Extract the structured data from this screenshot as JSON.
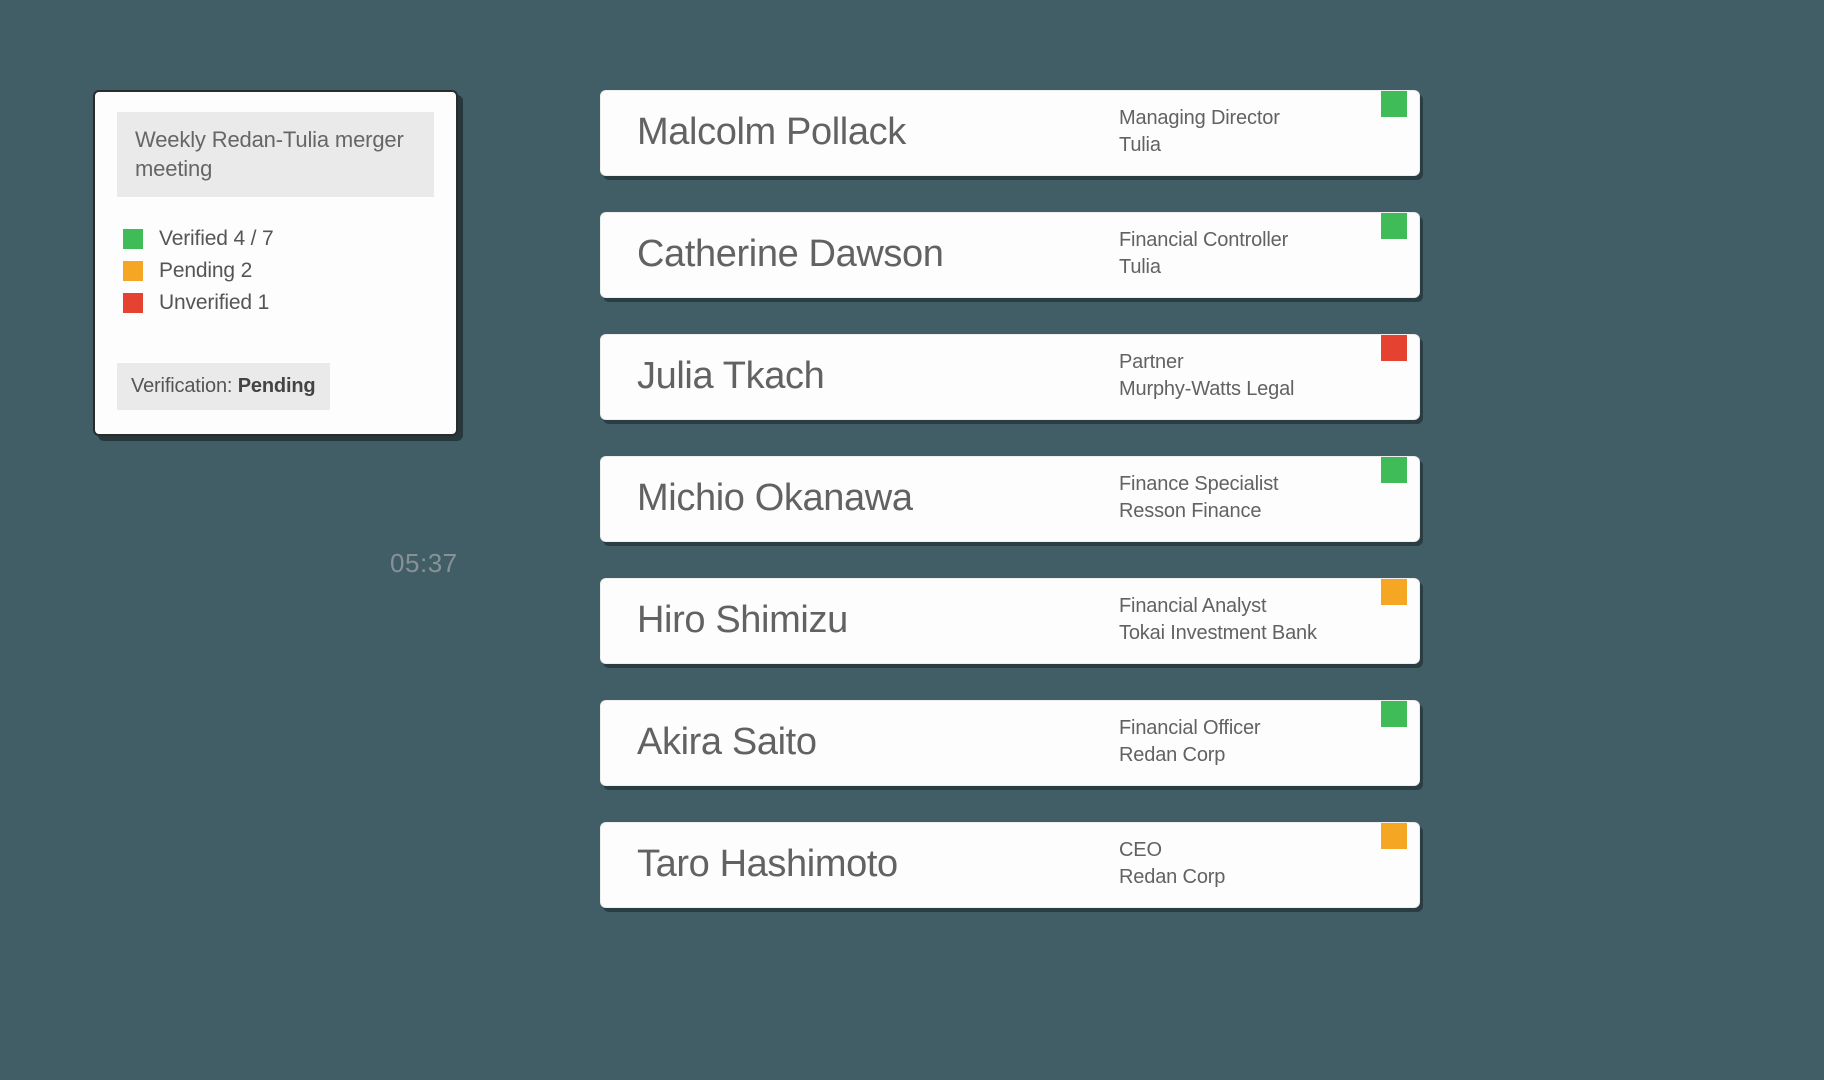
{
  "summary": {
    "title": "Weekly Redan-Tulia merger meeting",
    "legend": {
      "verified": {
        "label": "Verified 4 / 7",
        "color": "#3fbb58"
      },
      "pending": {
        "label": "Pending 2",
        "color": "#f5a623"
      },
      "unverified": {
        "label": "Unverified 1",
        "color": "#e64232"
      }
    },
    "status_prefix": "Verification: ",
    "status_value": "Pending"
  },
  "timer": "05:37",
  "status_colors": {
    "verified": "c-green",
    "pending": "c-orange",
    "unverified": "c-red"
  },
  "people": [
    {
      "name": "Malcolm Pollack",
      "role": "Managing Director",
      "org": "Tulia",
      "status": "verified"
    },
    {
      "name": "Catherine Dawson",
      "role": "Financial Controller",
      "org": "Tulia",
      "status": "verified"
    },
    {
      "name": "Julia Tkach",
      "role": "Partner",
      "org": "Murphy-Watts Legal",
      "status": "unverified"
    },
    {
      "name": "Michio Okanawa",
      "role": "Finance Specialist",
      "org": "Resson Finance",
      "status": "verified"
    },
    {
      "name": "Hiro Shimizu",
      "role": "Financial Analyst",
      "org": "Tokai Investment Bank",
      "status": "pending"
    },
    {
      "name": "Akira Saito",
      "role": "Financial Officer",
      "org": "Redan Corp",
      "status": "verified"
    },
    {
      "name": "Taro Hashimoto",
      "role": "CEO",
      "org": "Redan Corp",
      "status": "pending"
    }
  ]
}
